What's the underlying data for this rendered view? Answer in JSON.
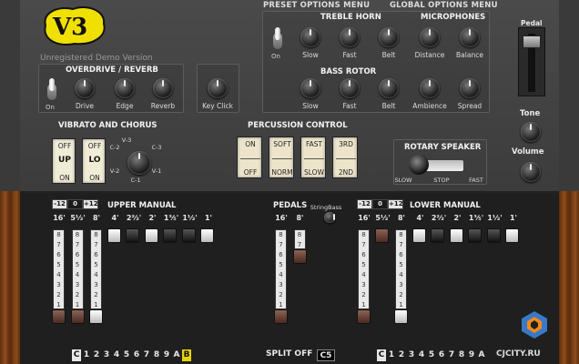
{
  "logo": {
    "text": "V3"
  },
  "demo_notice": "Unregistered Demo Version",
  "menus": {
    "preset": "PRESET OPTIONS MENU",
    "global": "GLOBAL OPTIONS MENU"
  },
  "overdrive": {
    "title": "OVERDRIVE / REVERB",
    "toggle_label": "On",
    "knobs": [
      "Drive",
      "Edge",
      "Reverb"
    ]
  },
  "key_click": {
    "label": "Key Click"
  },
  "treble_horn": {
    "title": "TREBLE HORN",
    "toggle_label": "On",
    "knobs": [
      "Slow",
      "Fast",
      "Belt"
    ]
  },
  "microphones": {
    "title": "MICROPHONES",
    "knobs": [
      "Distance",
      "Balance"
    ]
  },
  "bass_rotor": {
    "title": "BASS ROTOR",
    "knobs": [
      "Slow",
      "Fast",
      "Belt",
      "Ambience",
      "Spread"
    ]
  },
  "pedal": {
    "label": "Pedal"
  },
  "tone": {
    "label": "Tone"
  },
  "volume": {
    "label": "Volume"
  },
  "vibrato": {
    "title": "VIBRATO AND CHORUS",
    "switch1": {
      "top": "OFF",
      "mid": "UP",
      "bot": "ON"
    },
    "switch2": {
      "top": "OFF",
      "mid": "LO",
      "bot": "ON"
    },
    "selector": [
      "V-3",
      "C-2",
      "C-3",
      "V-2",
      "V-1",
      "C-1"
    ]
  },
  "percussion": {
    "title": "PERCUSSION CONTROL",
    "switches": [
      {
        "top": "ON",
        "bot": "OFF"
      },
      {
        "top": "SOFT",
        "bot": "NORM"
      },
      {
        "top": "FAST",
        "bot": "SLOW"
      },
      {
        "top": "3RD",
        "bot": "2ND"
      }
    ]
  },
  "rotary": {
    "title": "ROTARY SPEAKER",
    "slow": "SLOW",
    "stop": "STOP",
    "fast": "FAST"
  },
  "upper_manual": {
    "title": "UPPER MANUAL",
    "transpose": [
      "-12",
      "0",
      "+12"
    ],
    "footages": [
      "16'",
      "5⅓'",
      "8'",
      "4'",
      "2⅔'",
      "2'",
      "1⅗'",
      "1⅓'",
      "1'"
    ],
    "drawbar_levels": [
      8,
      8,
      8,
      0,
      0,
      0,
      0,
      0,
      0
    ]
  },
  "pedals": {
    "title": "PEDALS",
    "string_bass": "StringBass",
    "footages": [
      "16'",
      "8'"
    ],
    "drawbar_levels": [
      8,
      2
    ]
  },
  "lower_manual": {
    "title": "LOWER MANUAL",
    "transpose": [
      "-12",
      "0",
      "+12"
    ],
    "footages": [
      "16'",
      "5⅓'",
      "8'",
      "4'",
      "2⅔'",
      "2'",
      "1⅗'",
      "1⅓'",
      "1'"
    ],
    "drawbar_levels": [
      8,
      0,
      8,
      0,
      0,
      0,
      0,
      0,
      0
    ]
  },
  "drawbar_numbers": [
    "8",
    "7",
    "6",
    "5",
    "4",
    "3",
    "2",
    "1",
    "0"
  ],
  "presets_upper": [
    "C",
    "1",
    "2",
    "3",
    "4",
    "5",
    "6",
    "7",
    "8",
    "9",
    "A",
    "B"
  ],
  "presets_lower": [
    "C",
    "1",
    "2",
    "3",
    "4",
    "5",
    "6",
    "7",
    "8",
    "9",
    "A"
  ],
  "split": {
    "label": "SPLIT OFF",
    "value": "C5"
  },
  "watermark": "CJCITY.RU"
}
